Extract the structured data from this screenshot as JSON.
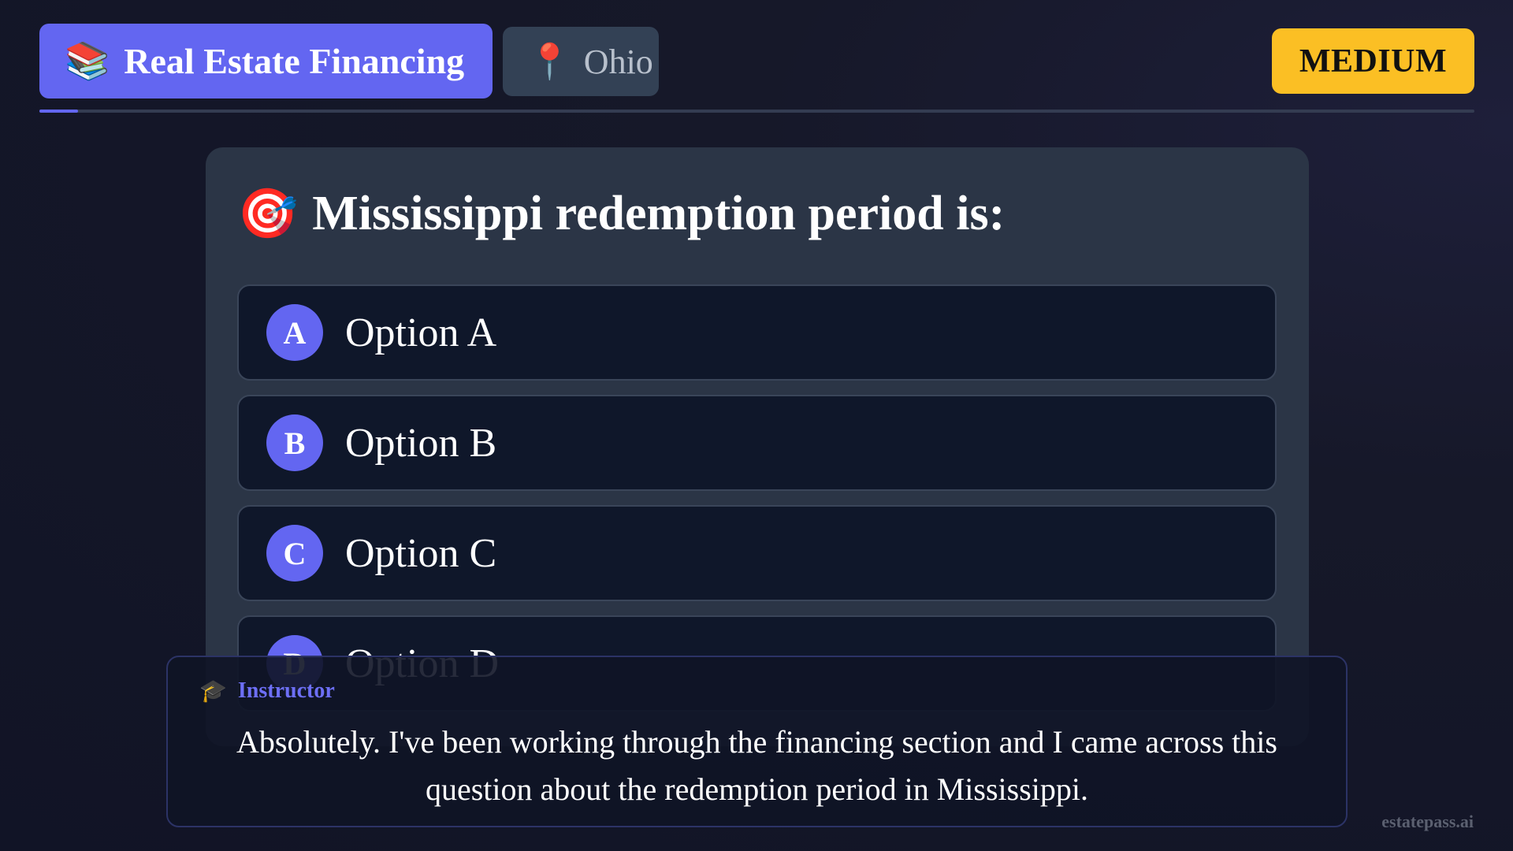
{
  "header": {
    "topic": {
      "icon": "books-icon",
      "emoji": "📚",
      "label": "Real Estate Financing"
    },
    "state": {
      "icon": "pushpin-icon",
      "emoji": "📍",
      "label": "Ohio"
    },
    "difficulty": "MEDIUM",
    "progress_fraction": 0.027
  },
  "question": {
    "icon": "target-icon",
    "emoji": "🎯",
    "text": "Mississippi redemption period is:",
    "options": [
      {
        "letter": "A",
        "text": "Option A"
      },
      {
        "letter": "B",
        "text": "Option B"
      },
      {
        "letter": "C",
        "text": "Option C"
      },
      {
        "letter": "D",
        "text": "Option D"
      }
    ]
  },
  "caption": {
    "icon": "graduation-cap-icon",
    "emoji": "🎓",
    "speaker": "Instructor",
    "text": "Absolutely. I've been working through the financing section and I came across this question about the redemption period in Mississippi."
  },
  "watermark": "estatepass.ai",
  "colors": {
    "accent": "#6366f1",
    "difficulty": "#fbbf24",
    "card": "#2b3546",
    "option_bg": "#0f172a"
  }
}
